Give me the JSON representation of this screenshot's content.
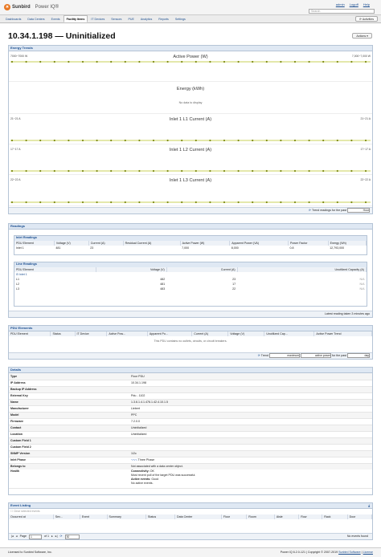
{
  "header": {
    "brand": "Sunbird",
    "product": "Power IQ®",
    "user_links": [
      "admin",
      "Logoff",
      "Help"
    ],
    "search_placeholder": "Search"
  },
  "nav": {
    "tabs": [
      "Dashboards",
      "Data Centers",
      "Events",
      "Facility Items",
      "IT Devices",
      "Sensors",
      "PUE",
      "Analytics",
      "Reports",
      "Settings"
    ],
    "active_tab": "Facility Items",
    "activities_label": "Activities"
  },
  "page": {
    "title": "10.34.1.198 — Uninitialized",
    "actions_label": "Actions"
  },
  "energy": {
    "title": "Energy Trends",
    "charts": [
      {
        "title": "Active Power (W)",
        "left": "7000~7000 W",
        "right": "7,000~7,000 W",
        "empty": ""
      },
      {
        "title": "Energy (kWh)",
        "left": "",
        "right": "",
        "empty": "No data to display"
      },
      {
        "title": "Inlet 1 L1 Current (A)",
        "left": "21~21 A",
        "right": "21~21 A",
        "empty": ""
      },
      {
        "title": "Inlet 1 L2 Current (A)",
        "left": "17~17 A",
        "right": "17~17 A",
        "empty": ""
      },
      {
        "title": "Inlet 1 L3 Current (A)",
        "left": "22~22 A",
        "right": "22~22 A",
        "empty": ""
      }
    ],
    "trend_label": "Trend readings for the past",
    "trend_value": "Hour"
  },
  "readings": {
    "title": "Readings",
    "inlet": {
      "title": "Inlet Readings",
      "headers": [
        "PDU Element",
        "Voltage (V)",
        "Current (A)",
        "Residual Current (A)",
        "Active Power (W)",
        "Apparent Power (VA)",
        "Power Factor",
        "Energy (Wh)"
      ],
      "row": [
        "Inlet 1",
        "481",
        "23",
        "",
        "7,000",
        "8,000",
        "0.8",
        "12,793,000"
      ]
    },
    "line": {
      "title": "Line Readings",
      "headers": [
        "PDU Element",
        "Voltage (V)",
        "Current (A)",
        "Unutilized Capacity (A)"
      ],
      "group": "Inlet 1",
      "rows": [
        [
          "L1",
          "482",
          "23",
          "N/A"
        ],
        [
          "L2",
          "481",
          "17",
          "N/A"
        ],
        [
          "L3",
          "483",
          "22",
          "N/A"
        ]
      ]
    },
    "footer": "Latest reading taken 3 minutes ago"
  },
  "pdu": {
    "title": "PDU Elements",
    "headers": [
      "PDU Element",
      "Status",
      "IT Device",
      "Active Pow...",
      "Apparent Po...",
      "Current (A)",
      "Voltage (V)",
      "Unutilized Cap...",
      "Active Power Trend"
    ],
    "empty": "This PDU contains no outlets, circuits, or circuit breakers.",
    "trend_label": "Trend",
    "trend_value": "maximum",
    "measure_value": "active power",
    "past_label": "for the past",
    "past_value": "day"
  },
  "details": {
    "title": "Details",
    "rows": [
      [
        "Type",
        "Floor PDU"
      ],
      [
        "IP Address",
        "10.34.1.198"
      ],
      [
        "Backup IP Address",
        ""
      ],
      [
        "External Key",
        "Pdu - 1102"
      ],
      [
        "Name",
        "1.3.6.1.4.1.476.1.42.4.10.1.5"
      ],
      [
        "Manufacturer",
        "Liebert"
      ],
      [
        "Model",
        "PPC"
      ],
      [
        "Firmware",
        "7.2.0.0"
      ],
      [
        "Contact",
        "Uninitialized"
      ],
      [
        "Location",
        "Uninitialized"
      ],
      [
        "Custom Field 1",
        ""
      ],
      [
        "Custom Field 2",
        ""
      ],
      [
        "SNMP Version",
        "1/2c"
      ],
      [
        "Inlet Phase",
        "Three Phase"
      ],
      [
        "Belongs to",
        "Not associated with a data center object."
      ]
    ],
    "health_label": "Health",
    "health": {
      "conn_label": "Connectivity:",
      "conn_value": "OK",
      "conn_note": "Most recent poll of the target PDU was successful.",
      "events_label": "Active events:",
      "events_value": "Good",
      "events_note": "No active events."
    }
  },
  "events": {
    "title": "Event Listing",
    "clear_label": "Clear selected events",
    "headers": [
      "Occurred at",
      "Sev...",
      "Event",
      "Summary",
      "Status",
      "Data Center",
      "Floor",
      "Room",
      "Aisle",
      "Row",
      "Rack",
      "Door"
    ],
    "page_label": "Page",
    "page_value": "1",
    "of_label": "of 1",
    "per_page": "30",
    "empty": "No events found"
  },
  "footer": {
    "left": "Licensed to Sunbird Software, Inc.",
    "right": "Power IQ 6.2.0-121 | Copyright © 2007-2019",
    "link1": "Sunbird Software",
    "link2": "License"
  },
  "colors": {
    "accent": "#1a4d8f",
    "brand": "#e87722",
    "series": "#b7c21f",
    "panel_header": "#dfe8f3"
  }
}
